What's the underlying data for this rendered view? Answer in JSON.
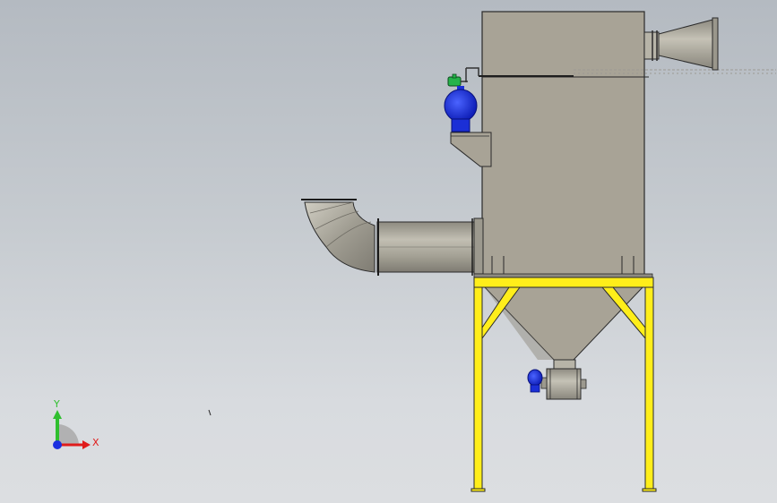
{
  "viewport": {
    "background_top": "#b4bac1",
    "background_bottom": "#dcdee1"
  },
  "model": {
    "body_color": "#a8a396",
    "duct_color": "#a6a397",
    "frame_color": "#ffee1a",
    "valve_color": "#1b2fd6",
    "solenoid_color": "#26b34a"
  },
  "triad": {
    "x_label": "X",
    "y_label": "Y",
    "x_color": "#e01b1b",
    "y_color": "#2fbf2f",
    "z_color": "#1b2fe0"
  }
}
